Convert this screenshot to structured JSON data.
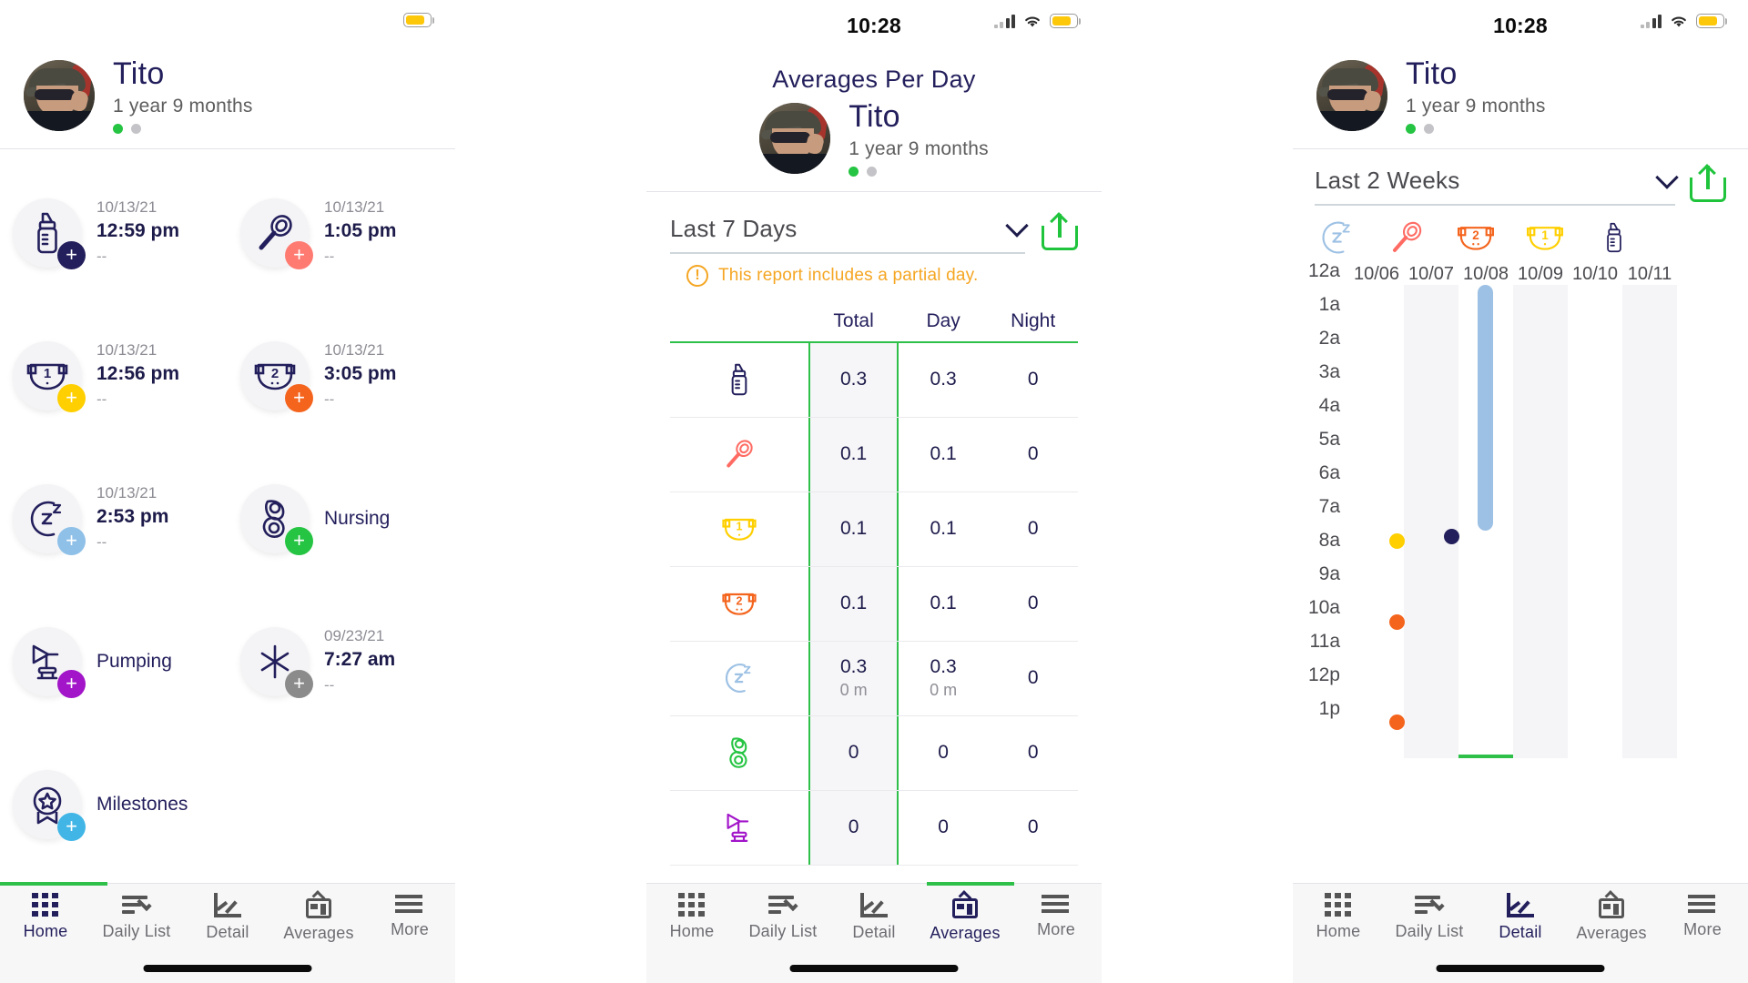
{
  "accent": {
    "green": "#2fc04a",
    "navy": "#231f5c",
    "amber": "#f5a623",
    "sky": "#9dc1e4"
  },
  "status": {
    "time": "10:28"
  },
  "profile": {
    "name": "Tito",
    "age": "1 year  9 months"
  },
  "home": {
    "tiles": [
      {
        "icon": "bottle-icon",
        "date": "10/13/21",
        "time": "12:59 pm",
        "sub": "--",
        "label": "",
        "badge_color": "#231f5c"
      },
      {
        "icon": "spoon-icon",
        "date": "10/13/21",
        "time": "1:05 pm",
        "sub": "--",
        "label": "",
        "badge_color": "#ff7b72"
      },
      {
        "icon": "diaper-1-icon",
        "date": "10/13/21",
        "time": "12:56 pm",
        "sub": "--",
        "label": "",
        "badge_color": "#ffcf00"
      },
      {
        "icon": "diaper-2-icon",
        "date": "10/13/21",
        "time": "3:05 pm",
        "sub": "--",
        "label": "",
        "badge_color": "#f4641d"
      },
      {
        "icon": "sleep-icon",
        "date": "10/13/21",
        "time": "2:53 pm",
        "sub": "--",
        "label": "",
        "badge_color": "#8fc0e8"
      },
      {
        "icon": "nursing-icon",
        "date": "",
        "time": "",
        "sub": "",
        "label": "Nursing",
        "badge_color": "#25c442"
      },
      {
        "icon": "pumping-icon",
        "date": "",
        "time": "",
        "sub": "",
        "label": "Pumping",
        "badge_color": "#a215c9"
      },
      {
        "icon": "other-icon",
        "date": "09/23/21",
        "time": "7:27 am",
        "sub": "--",
        "label": "",
        "badge_color": "#8b8b8b"
      },
      {
        "icon": "milestones-icon",
        "date": "",
        "time": "",
        "sub": "",
        "label": "Milestones",
        "badge_color": "#41b6e6"
      }
    ]
  },
  "tabbar": {
    "items": [
      {
        "label": "Home",
        "icon": "home-grid-icon"
      },
      {
        "label": "Daily List",
        "icon": "daily-list-icon"
      },
      {
        "label": "Detail",
        "icon": "detail-chart-icon"
      },
      {
        "label": "Averages",
        "icon": "averages-icon"
      },
      {
        "label": "More",
        "icon": "more-hamburger-icon"
      }
    ],
    "active_panel1": "Home",
    "active_panel2": "Averages",
    "active_panel3": "Detail"
  },
  "averages": {
    "title": "Averages Per Day",
    "range_value": "Last 7 Days",
    "warning": "This report includes a partial day.",
    "columns": [
      "",
      "Total",
      "Day",
      "Night"
    ],
    "rows": [
      {
        "icon": "bottle-icon",
        "total": "0.3",
        "total_sub": "",
        "day": "0.3",
        "day_sub": "",
        "night": "0",
        "night_sub": ""
      },
      {
        "icon": "spoon-icon",
        "total": "0.1",
        "total_sub": "",
        "day": "0.1",
        "day_sub": "",
        "night": "0",
        "night_sub": ""
      },
      {
        "icon": "diaper-1-icon",
        "total": "0.1",
        "total_sub": "",
        "day": "0.1",
        "day_sub": "",
        "night": "0",
        "night_sub": ""
      },
      {
        "icon": "diaper-2-icon",
        "total": "0.1",
        "total_sub": "",
        "day": "0.1",
        "day_sub": "",
        "night": "0",
        "night_sub": ""
      },
      {
        "icon": "sleep-icon",
        "total": "0.3",
        "total_sub": "0 m",
        "day": "0.3",
        "day_sub": "0 m",
        "night": "0",
        "night_sub": ""
      },
      {
        "icon": "nursing-icon",
        "total": "0",
        "total_sub": "",
        "day": "0",
        "day_sub": "",
        "night": "0",
        "night_sub": ""
      },
      {
        "icon": "pumping-icon",
        "total": "0",
        "total_sub": "",
        "day": "0",
        "day_sub": "",
        "night": "0",
        "night_sub": ""
      }
    ]
  },
  "detail": {
    "range_value": "Last 2 Weeks",
    "legend": [
      {
        "icon": "sleep-icon",
        "color": "#9dc1e4"
      },
      {
        "icon": "spoon-icon",
        "color": "#ff6b63"
      },
      {
        "icon": "diaper-2-icon",
        "color": "#f4641d"
      },
      {
        "icon": "diaper-1-icon",
        "color": "#ffcf00"
      },
      {
        "icon": "bottle-icon",
        "color": "#231f5c"
      }
    ]
  },
  "chart_data": {
    "type": "scatter",
    "title": "",
    "xlabel": "",
    "ylabel": "",
    "categories": [
      "10/06",
      "10/07",
      "10/08",
      "10/09",
      "10/10",
      "10/11"
    ],
    "ytick_labels": [
      "12a",
      "1a",
      "2a",
      "3a",
      "4a",
      "5a",
      "6a",
      "7a",
      "8a",
      "9a",
      "10a",
      "11a",
      "12p",
      "1p"
    ],
    "ylim": [
      0,
      13.5
    ],
    "grid": false,
    "legend_position": "top",
    "series": [
      {
        "name": "sleep",
        "type": "bar",
        "color": "#9dc1e4",
        "points": [
          {
            "x": "10/08",
            "start_hour": 0,
            "end_hour": 7.1
          }
        ]
      },
      {
        "name": "diaper-1",
        "type": "point",
        "color": "#ffcf00",
        "points": [
          {
            "x": "10/06",
            "hour": 7.6
          }
        ]
      },
      {
        "name": "bottle",
        "type": "point",
        "color": "#231f5c",
        "points": [
          {
            "x": "10/07",
            "hour": 7.45
          }
        ]
      },
      {
        "name": "diaper-2",
        "type": "point",
        "color": "#f4641d",
        "points": [
          {
            "x": "10/06",
            "hour": 10.0
          },
          {
            "x": "10/06",
            "hour": 13.0
          }
        ]
      }
    ]
  }
}
